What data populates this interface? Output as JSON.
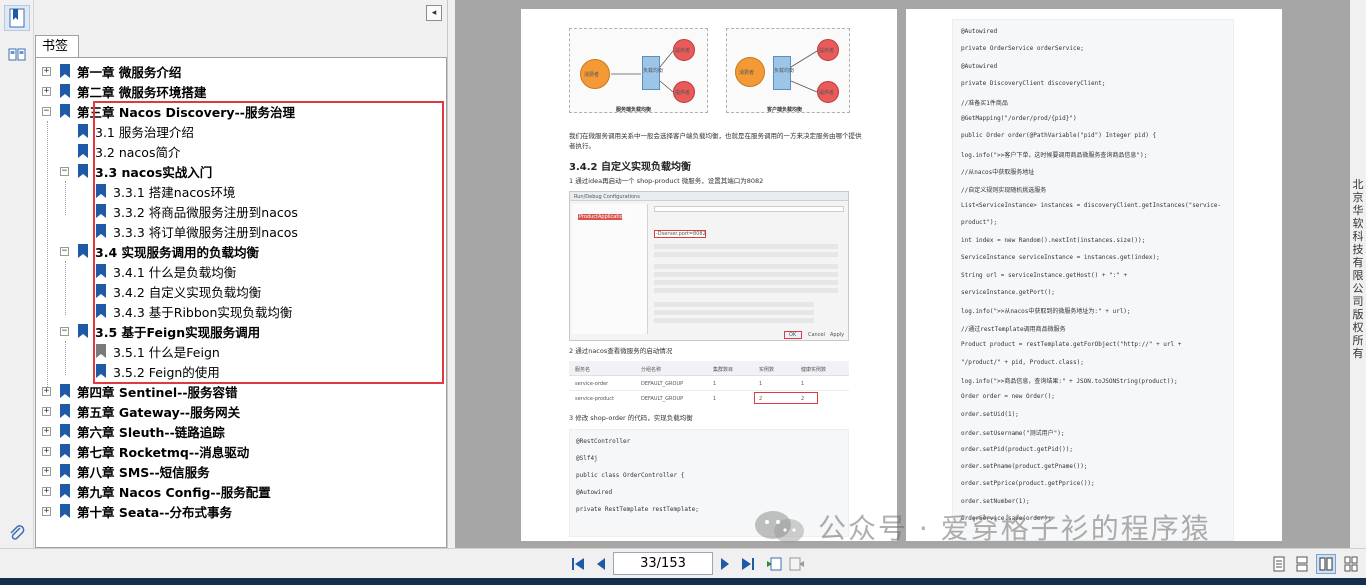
{
  "panel": {
    "tab_label": "书签",
    "collapse_glyph": "◂"
  },
  "bookmarks": [
    {
      "label": "第一章 微服务介绍",
      "bold": true,
      "level": 0,
      "expander": "+"
    },
    {
      "label": "第二章 微服务环境搭建",
      "bold": true,
      "level": 0,
      "expander": "+"
    },
    {
      "label": "第三章 Nacos Discovery--服务治理",
      "bold": true,
      "level": 0,
      "expander": "−"
    },
    {
      "label": "3.1 服务治理介绍",
      "bold": false,
      "level": 1,
      "expander": ""
    },
    {
      "label": "3.2 nacos简介",
      "bold": false,
      "level": 1,
      "expander": ""
    },
    {
      "label": "3.3 nacos实战入门",
      "bold": true,
      "level": 1,
      "expander": "−"
    },
    {
      "label": "3.3.1 搭建nacos环境",
      "bold": false,
      "level": 2,
      "expander": ""
    },
    {
      "label": "3.3.2 将商品微服务注册到nacos",
      "bold": false,
      "level": 2,
      "expander": ""
    },
    {
      "label": "3.3.3 将订单微服务注册到nacos",
      "bold": false,
      "level": 2,
      "expander": ""
    },
    {
      "label": "3.4 实现服务调用的负载均衡",
      "bold": true,
      "level": 1,
      "expander": "−"
    },
    {
      "label": "3.4.1 什么是负载均衡",
      "bold": false,
      "level": 2,
      "expander": ""
    },
    {
      "label": "3.4.2 自定义实现负载均衡",
      "bold": false,
      "level": 2,
      "expander": ""
    },
    {
      "label": "3.4.3 基于Ribbon实现负载均衡",
      "bold": false,
      "level": 2,
      "expander": ""
    },
    {
      "label": "3.5 基于Feign实现服务调用",
      "bold": true,
      "level": 1,
      "expander": "−"
    },
    {
      "label": "3.5.1 什么是Feign",
      "bold": false,
      "level": 2,
      "expander": "",
      "grey": true
    },
    {
      "label": "3.5.2 Feign的使用",
      "bold": false,
      "level": 2,
      "expander": ""
    },
    {
      "label": "第四章 Sentinel--服务容错",
      "bold": true,
      "level": 0,
      "expander": "+"
    },
    {
      "label": "第五章 Gateway--服务网关",
      "bold": true,
      "level": 0,
      "expander": "+"
    },
    {
      "label": "第六章 Sleuth--链路追踪",
      "bold": true,
      "level": 0,
      "expander": "+"
    },
    {
      "label": "第七章 Rocketmq--消息驱动",
      "bold": true,
      "level": 0,
      "expander": "+"
    },
    {
      "label": "第八章 SMS--短信服务",
      "bold": true,
      "level": 0,
      "expander": "+"
    },
    {
      "label": "第九章 Nacos Config--服务配置",
      "bold": true,
      "level": 0,
      "expander": "+"
    },
    {
      "label": "第十章 Seata--分布式事务",
      "bold": true,
      "level": 0,
      "expander": "+"
    }
  ],
  "page_left": {
    "fig_left_caption": "服务端负载均衡",
    "fig_right_caption": "客户端负载均衡",
    "fig_node_a": "消费者",
    "fig_node_lb": "负载均衡",
    "fig_node_b": "提供者",
    "fig_node_c": "提供者",
    "para1": "我们在微服务调用关系中一般会选择客户端负载均衡，也就是在服务调用的一方来决定服务由哪个提供",
    "para1b": "者执行。",
    "heading": "3.4.2 自定义实现负载均衡",
    "step1": "1 通过idea再启动一个 shop-product 微服务，设置其端口为8082",
    "step2": "2 通过nacos查看微服务的启动情况",
    "table_headers": [
      "服务名",
      "分组名称",
      "集群数目",
      "实例数",
      "健康实例数"
    ],
    "table_rows": [
      [
        "service-order",
        "DEFAULT_GROUP",
        "1",
        "1",
        "1"
      ],
      [
        "service-product",
        "DEFAULT_GROUP",
        "1",
        "2",
        "2"
      ]
    ],
    "step3": "3 修改 shop-order 的代码，实现负载均衡",
    "code": [
      "@RestController",
      "@Slf4j",
      "public class OrderController {",
      "@Autowired",
      "private RestTemplate restTemplate;"
    ],
    "dialog_title": "Run/Debug Configurations",
    "dialog_name": "ProductApplication2",
    "dialog_vm": "-Dserver.port=8082",
    "dialog_ok": "OK",
    "dialog_cancel": "Cancel",
    "dialog_apply": "Apply"
  },
  "page_right": {
    "code": [
      "@Autowired",
      "private OrderService orderService;",
      "@Autowired",
      "private DiscoveryClient discoveryClient;",
      "//准备买1件商品",
      "@GetMapping(\"/order/prod/{pid}\")",
      "public Order order(@PathVariable(\"pid\") Integer pid) {",
      "log.info(\">>客户下单，这时候要调用商品微服务查询商品信息\");",
      "//从nacos中获取服务地址",
      "//自定义规则实现随机挑选服务",
      "List<ServiceInstance> instances = discoveryClient.getInstances(\"service-",
      "product\");",
      "int index = new Random().nextInt(instances.size());",
      "ServiceInstance serviceInstance = instances.get(index);",
      "String url = serviceInstance.getHost() + \":\" +",
      "serviceInstance.getPort();",
      "log.info(\">>从nacos中获取到的微服务地址为:\" + url);",
      "//通过restTemplate调用商品微服务",
      "Product product = restTemplate.getForObject(\"http://\" + url +",
      "\"/product/\" + pid, Product.class);",
      "log.info(\">>商品信息，查询结果:\" + JSON.toJSONString(product));",
      "Order order = new Order();",
      "order.setUid(1);",
      "order.setUsername(\"测试用户\");",
      "order.setPid(product.getPid());",
      "order.setPname(product.getPname());",
      "order.setPprice(product.getPprice());",
      "order.setNumber(1);",
      "orderService.save(order);"
    ]
  },
  "watermark": {
    "text": "公众号 · 爱穿格子衫的程序猿"
  },
  "side_vertical_text": "北京华软科技有限公司版权所有",
  "navigation": {
    "page_indicator": "33/153"
  },
  "colors": {
    "highlight_border": "#e03a40",
    "bookmark_blue": "#1f5aa6",
    "bookmark_grey": "#7a7a7a",
    "doc_background": "#a6a6a6",
    "taskbar": "#12304e"
  },
  "icons": {
    "strip": [
      "bookmarks-panel-icon",
      "page-thumbnails-icon",
      "attachments-icon"
    ],
    "nav": [
      "first-page-icon",
      "previous-page-icon",
      "next-page-icon",
      "last-page-icon",
      "previous-view-icon",
      "next-view-icon"
    ],
    "view": [
      "single-page-view-icon",
      "continuous-view-icon",
      "two-page-view-icon",
      "two-page-continuous-view-icon"
    ]
  }
}
